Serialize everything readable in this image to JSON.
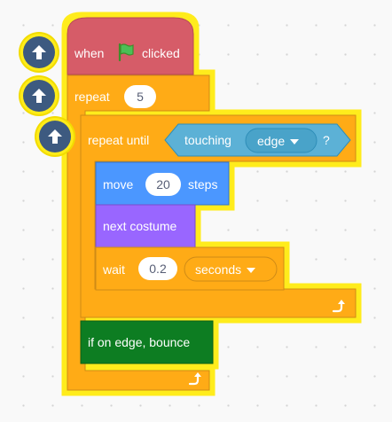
{
  "blocks": {
    "hat": {
      "label_prefix": "when",
      "label_suffix": "clicked",
      "icon": "green-flag-icon",
      "color": "#d65c68"
    },
    "repeat": {
      "label": "repeat",
      "count": "5",
      "color": "#ffab19"
    },
    "repeat_until": {
      "label": "repeat until",
      "color": "#ffab19"
    },
    "touching": {
      "label": "touching",
      "option": "edge",
      "suffix": "?",
      "color": "#5cb1d6"
    },
    "move": {
      "label": "move",
      "steps": "20",
      "suffix": "steps",
      "color": "#4c97ff"
    },
    "next_costume": {
      "label": "next costume",
      "color": "#9966ff"
    },
    "wait": {
      "label": "wait",
      "value": "0.2",
      "unit": "seconds",
      "color": "#ffab19"
    },
    "bounce": {
      "label": "if on edge, bounce",
      "color": "#0a7d22"
    }
  },
  "buttons": {
    "move_up_icon": "arrow-up-icon"
  },
  "colors": {
    "glow": "#ffec1a",
    "up_button": "#3d5a80"
  }
}
